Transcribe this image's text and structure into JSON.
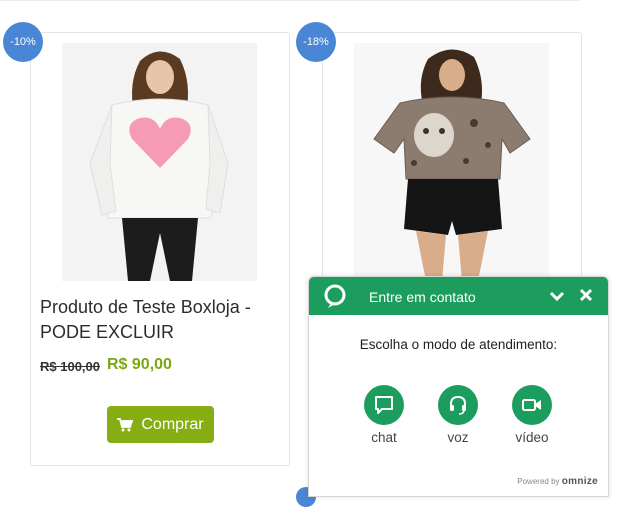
{
  "products": [
    {
      "discount": "-10%",
      "name": "Produto de Teste Boxloja - PODE EXCLUIR",
      "old_price": "R$ 100,00",
      "new_price": "R$ 90,00",
      "buy_label": "Comprar",
      "image_icon": "sweater-heart-product-image"
    },
    {
      "discount": "-18%",
      "image_icon": "leopard-tshirt-product-image"
    }
  ],
  "widget": {
    "title": "Entre em contato",
    "prompt": "Escolha o modo de atendimento:",
    "options": [
      {
        "label": "chat",
        "icon": "chat-icon"
      },
      {
        "label": "voz",
        "icon": "headset-icon"
      },
      {
        "label": "vídeo",
        "icon": "video-camera-icon"
      }
    ],
    "powered_by": "Powered by",
    "brand": "omnize",
    "accent_color": "#1c9d5e"
  },
  "colors": {
    "badge": "#4a86d6",
    "price_green": "#7ba711",
    "button_green": "#86ae12"
  }
}
